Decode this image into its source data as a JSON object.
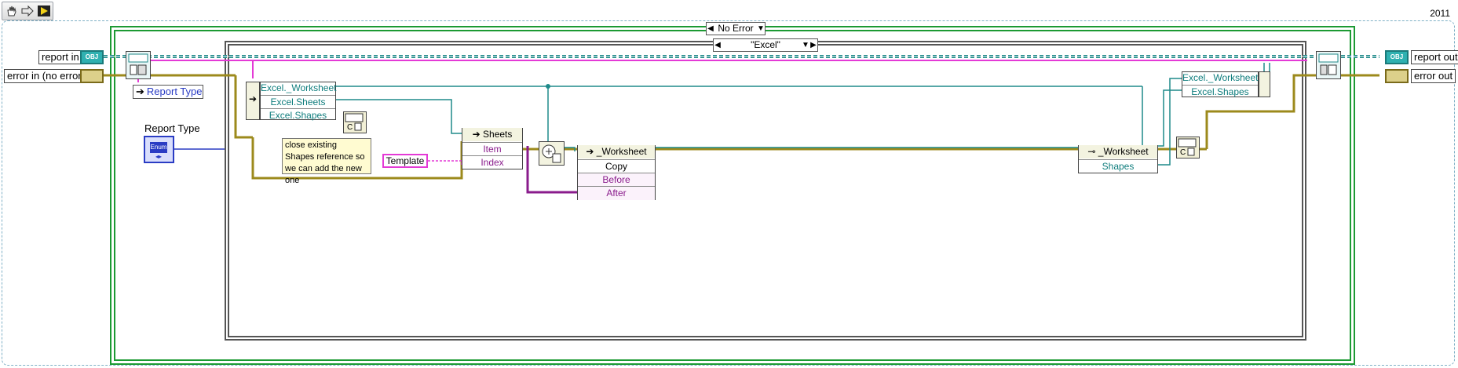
{
  "version_label": "2011",
  "toolbar": {
    "icons": [
      "hand-tool-icon",
      "step-icon",
      "run-highlight-icon"
    ]
  },
  "outer_case": {
    "selector_value": "No Error"
  },
  "inner_case": {
    "selector_value": "\"Excel\""
  },
  "terminals": {
    "report_in": "report in",
    "error_in": "error in (no error)",
    "report_out": "report out",
    "error_out": "error out",
    "obj_tag": "OBJ"
  },
  "controls": {
    "report_type_label": "Report Type",
    "report_type_constant": "Report Type",
    "enum_tag": "Enum"
  },
  "property_node_1": {
    "class": "Excel._Worksheet",
    "props": [
      "Excel.Sheets",
      "Excel.Shapes"
    ]
  },
  "sheets_node": {
    "title": "Sheets",
    "props": [
      "Item",
      "Index"
    ]
  },
  "template_constant": "Template",
  "worksheet_copy_node": {
    "title": "_Worksheet",
    "props": [
      "Copy",
      "Before",
      "After"
    ]
  },
  "worksheet_prop_node": {
    "title": "_Worksheet",
    "props": [
      "Shapes"
    ]
  },
  "bundle_node": {
    "items": [
      "Excel._Worksheet",
      "Excel.Shapes"
    ]
  },
  "comment_text": "close existing Shapes reference so we can add the new one",
  "colors": {
    "refnum_wire": "#1f8a8a",
    "error_wire": "#9c8a1c",
    "string_wire": "#e43ad6",
    "enum_wire": "#2a3cc4",
    "case_frame": "#1c9a33"
  }
}
